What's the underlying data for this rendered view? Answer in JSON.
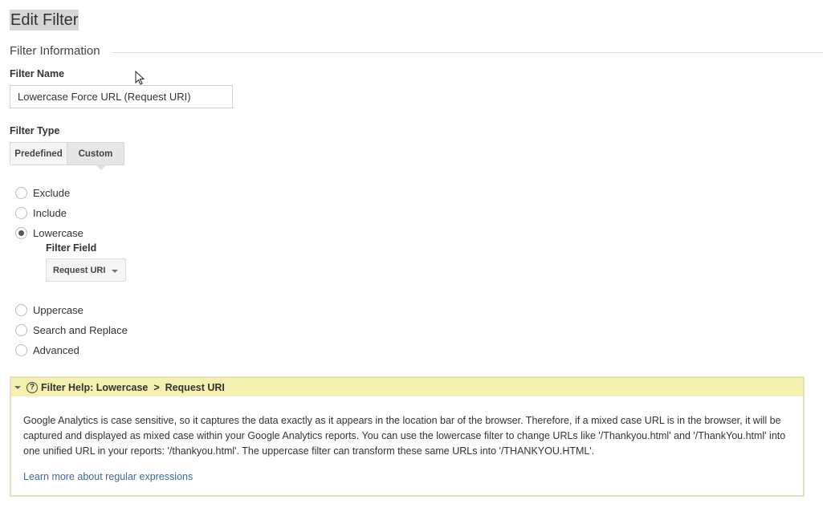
{
  "page": {
    "title": "Edit Filter"
  },
  "section": {
    "title": "Filter Information"
  },
  "filter_name": {
    "label": "Filter Name",
    "value": "Lowercase Force URL (Request URI)"
  },
  "filter_type": {
    "label": "Filter Type",
    "tabs": [
      {
        "label": "Predefined",
        "selected": false
      },
      {
        "label": "Custom",
        "selected": true
      }
    ],
    "options": [
      {
        "label": "Exclude",
        "checked": false
      },
      {
        "label": "Include",
        "checked": false
      },
      {
        "label": "Lowercase",
        "checked": true
      },
      {
        "label": "Uppercase",
        "checked": false
      },
      {
        "label": "Search and Replace",
        "checked": false
      },
      {
        "label": "Advanced",
        "checked": false
      }
    ],
    "filter_field": {
      "label": "Filter Field",
      "selected": "Request URI"
    }
  },
  "help": {
    "title": "Filter Help: Lowercase  >  Request URI",
    "body": "Google Analytics is case sensitive, so it captures the data exactly as it appears in the location bar of the browser. Therefore, if a mixed case URL is in the browser, it will be captured and displayed as mixed case within your Google Analytics reports. You can use the lowercase filter to change URLs like '/Thankyou.html' and '/ThankYou.html' into one unified URL in your reports: '/thankyou.html'. The uppercase filter can transform these same URLs into '/THANKYOU.HTML'.",
    "link": "Learn more about regular expressions"
  }
}
